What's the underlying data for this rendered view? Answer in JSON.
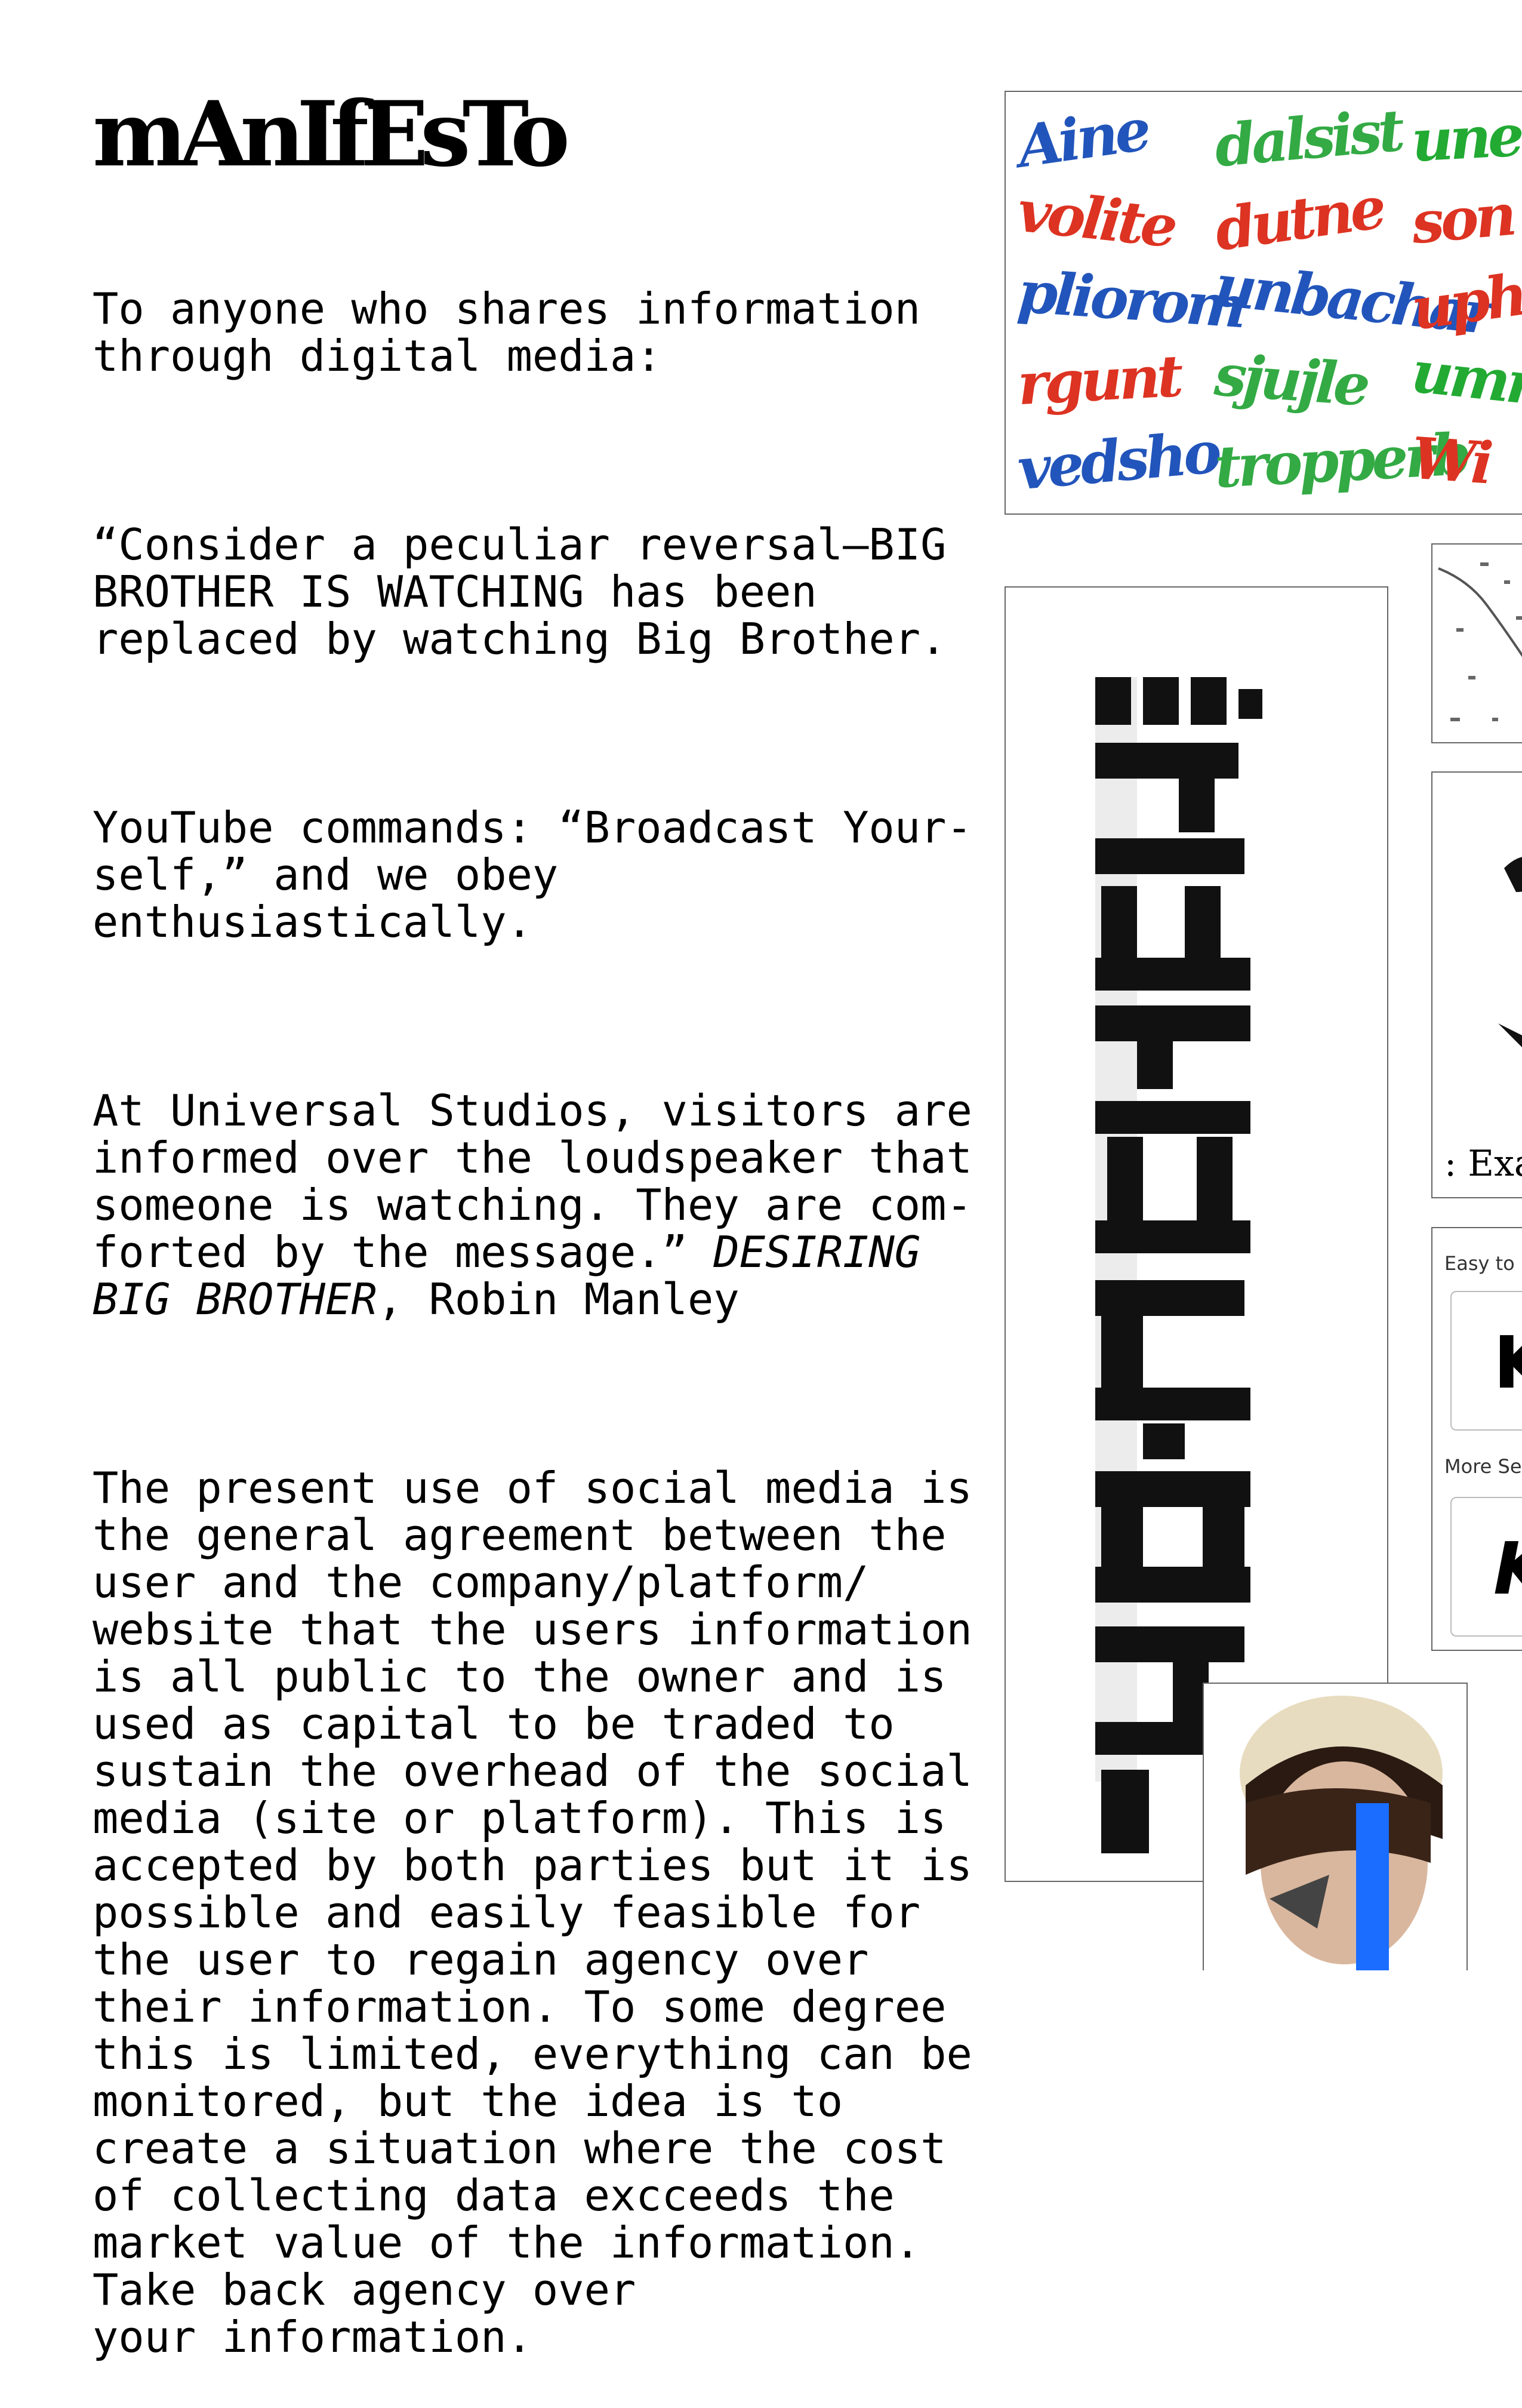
{
  "document": {
    "title": "mAnIfEsTo",
    "intro": "To anyone who shares information\nthrough digital media:",
    "quote_p1": "“Consider a peculiar reversal—BIG\nBROTHER IS WATCHING has been\nreplaced by watching Big Brother.",
    "quote_p2": "YouTube commands: “Broadcast Your-\nself,” and we obey\nenthusiastically.",
    "quote_p3_text": "At Universal Studios, visitors are\ninformed over the loudspeaker that\nsomeone is watching. They are com-\nforted by the message.” ",
    "quote_source_italic": "DESIRING\nBIG BROTHER",
    "quote_author": ", Robin Manley",
    "body_paragraph": "The present use of social media is\nthe general agreement between the\nuser and the company/platform/\nwebsite that the users information\nis all public to the owner and is\nused as capital to be traded to\nsustain the overhead of the social\nmedia (site or platform). This is\naccepted by both parties but it is\npossible and easily feasible for\nthe user to regain agency over\ntheir information. To some degree\nthis is limited, everything can be\nmonitored, but the idea is to\ncreate a situation where the cost\nof collecting data excceeds the\nmarket value of the information.\nTake back agency over\nyour information."
  },
  "images": {
    "captcha_grid": {
      "words": [
        {
          "text": "Aine",
          "color": "#2255bb"
        },
        {
          "text": "dalsist",
          "color": "#33aa44"
        },
        {
          "text": "une",
          "color": "#22aa33"
        },
        {
          "text": "volite",
          "color": "#dd3322"
        },
        {
          "text": "dutne",
          "color": "#dd3322"
        },
        {
          "text": "son",
          "color": "#dd3322"
        },
        {
          "text": "pliorom",
          "color": "#2255bb"
        },
        {
          "text": "unbachar",
          "color": "#2255bb"
        },
        {
          "text": "upho",
          "color": "#dd3322"
        },
        {
          "text": "rgunt",
          "color": "#dd3322"
        },
        {
          "text": "sjujle",
          "color": "#33aa44"
        },
        {
          "text": "umne",
          "color": "#22aa33"
        },
        {
          "text": "vedsho",
          "color": "#2255bb"
        },
        {
          "text": "tropperb",
          "color": "#33aa44"
        },
        {
          "text": "Wi",
          "color": "#dd3322"
        }
      ]
    },
    "large_captcha": {
      "icon": "distorted-captcha-image"
    },
    "map": {
      "icon": "map-image"
    },
    "example_panel": {
      "caption": ": Exan"
    },
    "security_panel": {
      "easy_label": "Easy to U",
      "easy_glyph": "K",
      "secure_label": "More Sec",
      "secure_glyph": "KS"
    },
    "portrait": {
      "icon": "portrait-photo",
      "accent": "#1a6dff"
    }
  }
}
